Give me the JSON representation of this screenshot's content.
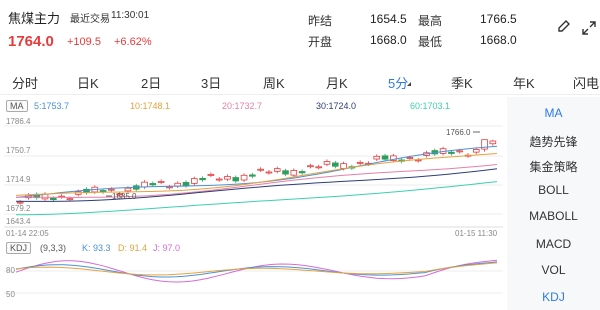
{
  "header": {
    "title": "焦煤主力",
    "last_trade_label": "最近交易",
    "last_trade_time": "11:30:01",
    "price": "1764.0",
    "change": "+109.5",
    "change_pct": "+6.62%",
    "quotes": [
      {
        "label": "昨结",
        "value": "1654.5"
      },
      {
        "label": "最高",
        "value": "1766.5"
      },
      {
        "label": "开盘",
        "value": "1668.0"
      },
      {
        "label": "最低",
        "value": "1668.0"
      }
    ],
    "icons": [
      "edit-icon",
      "expand-icon"
    ]
  },
  "tabs": [
    {
      "label": "分时"
    },
    {
      "label": "日K"
    },
    {
      "label": "2日"
    },
    {
      "label": "3日"
    },
    {
      "label": "周K"
    },
    {
      "label": "月K"
    },
    {
      "label": "5分",
      "active": true
    },
    {
      "label": "季K"
    },
    {
      "label": "年K"
    },
    {
      "label": "闪电"
    }
  ],
  "ma_badge": "MA",
  "ma_legend": [
    {
      "label": "5:1753.7",
      "color": "#4a90d9"
    },
    {
      "label": "10:1748.1",
      "color": "#e6a23c"
    },
    {
      "label": "20:1732.7",
      "color": "#e87fa6"
    },
    {
      "label": "30:1724.0",
      "color": "#2c3e7a"
    },
    {
      "label": "60:1703.1",
      "color": "#3ccfb0"
    }
  ],
  "price_axis": [
    "1786.4",
    "1750.7",
    "1714.9",
    "1679.2",
    "1643.4"
  ],
  "annotations": {
    "high": "1766.0",
    "low": "1685.0"
  },
  "time_axis": {
    "start": "01-14 22:05",
    "end": "01-15 11:30"
  },
  "kdj_badge": "KDJ",
  "kdj_params": "(9,3,3)",
  "kdj_legend": [
    {
      "label": "K: 93.3",
      "color": "#4a90d9"
    },
    {
      "label": "D: 91.4",
      "color": "#e6a23c"
    },
    {
      "label": "J: 97.0",
      "color": "#d36bd8"
    }
  ],
  "kdj_axis": [
    "80",
    "50"
  ],
  "sidebar": [
    "MA",
    "趋势先锋",
    "集金策略",
    "BOLL",
    "MABOLL",
    "MACD",
    "VOL",
    "KDJ"
  ],
  "sidebar_active": [
    "MA",
    "KDJ"
  ],
  "colors": {
    "up": "#e63b3b",
    "down": "#2e9e5b",
    "accent": "#2d7be5"
  }
}
